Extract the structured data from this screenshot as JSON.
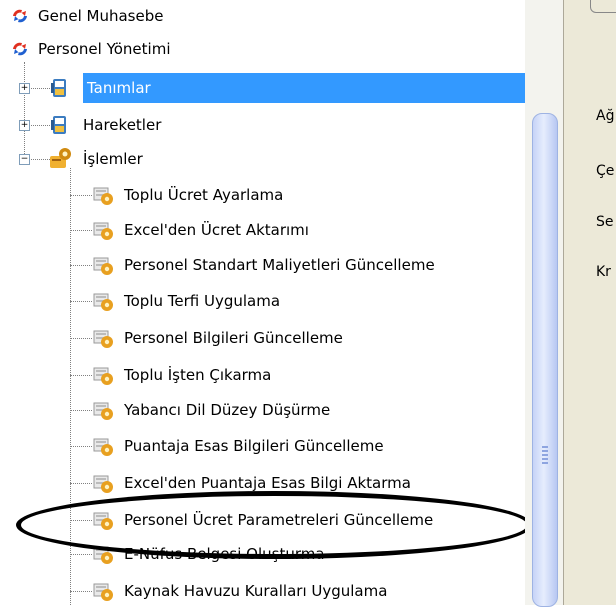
{
  "tree": {
    "root_items": [
      {
        "label": "Genel Muhasebe",
        "icon": "module-icon"
      },
      {
        "label": "Personel Yönetimi",
        "icon": "module-icon"
      }
    ],
    "folders": [
      {
        "label": "Tanımlar",
        "expander": "+",
        "icon": "folder-icon",
        "selected": true
      },
      {
        "label": "Hareketler",
        "expander": "+",
        "icon": "folder-icon"
      },
      {
        "label": "İşlemler",
        "expander": "−",
        "icon": "tools-folder-icon"
      }
    ],
    "operations": [
      {
        "label": "Toplu Ücret Ayarlama"
      },
      {
        "label": "Excel'den Ücret Aktarımı"
      },
      {
        "label": "Personel Standart Maliyetleri Güncelleme"
      },
      {
        "label": "Toplu Terfi Uygulama"
      },
      {
        "label": "Personel Bilgileri Güncelleme"
      },
      {
        "label": "Toplu İşten Çıkarma"
      },
      {
        "label": "Yabancı Dil Düzey Düşürme"
      },
      {
        "label": "Puantaja Esas Bilgileri Güncelleme"
      },
      {
        "label": "Excel'den Puantaja Esas Bilgi Aktarma"
      },
      {
        "label": "Personel Ücret Parametreleri Güncelleme"
      },
      {
        "label": "E-Nüfus Belgesi Oluşturma"
      },
      {
        "label": "Kaynak Havuzu Kuralları Uygulama"
      }
    ],
    "colors": {
      "selection": "#3399ff",
      "icon_orange": "#e8a020"
    }
  },
  "right_panel": {
    "labels": [
      "Ağ",
      "Çe",
      "Se",
      "Kr"
    ]
  }
}
